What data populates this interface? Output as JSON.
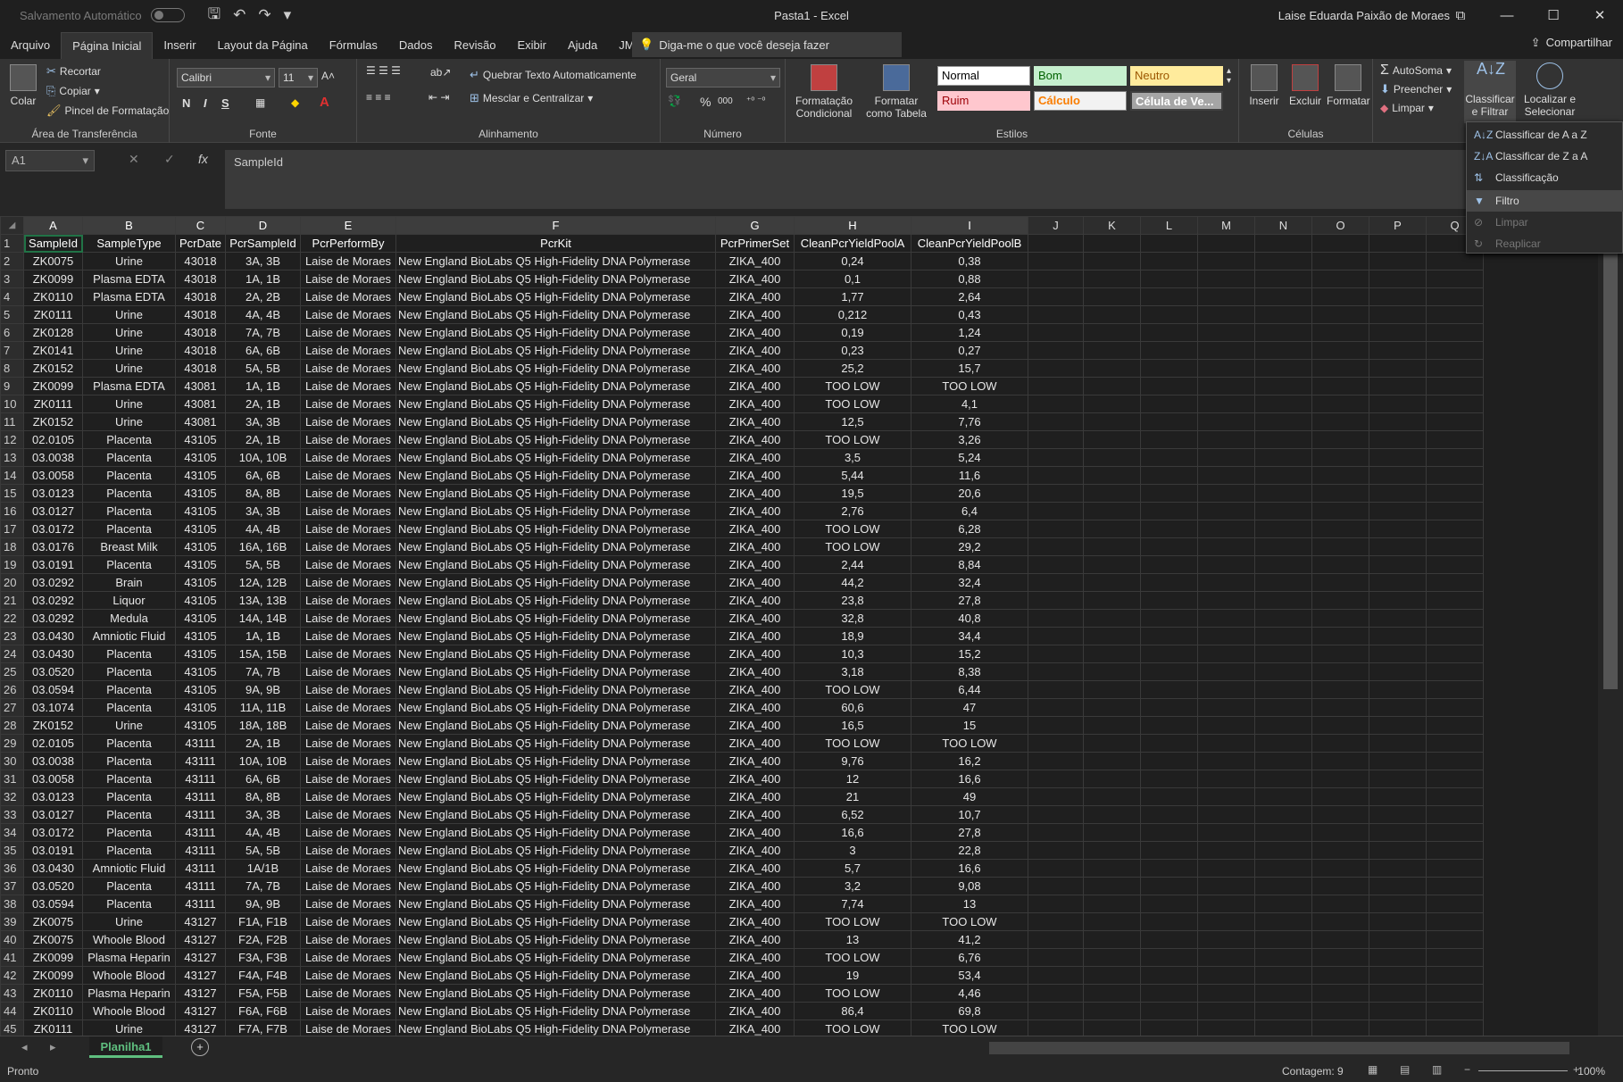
{
  "titlebar": {
    "autosave": "Salvamento Automático",
    "doc_title": "Pasta1  -  Excel",
    "user": "Laise Eduarda Paixão de Moraes",
    "minimize": "—",
    "restore": "☐",
    "close": "✕"
  },
  "tabs": [
    "Arquivo",
    "Página Inicial",
    "Inserir",
    "Layout da Página",
    "Fórmulas",
    "Dados",
    "Revisão",
    "Exibir",
    "Ajuda",
    "JMP"
  ],
  "tellme": "Diga-me o que você deseja fazer",
  "share": "Compartilhar",
  "ribbon": {
    "clipboard": {
      "label": "Área de Transferência",
      "paste": "Colar",
      "cut": "Recortar",
      "copy": "Copiar",
      "painter": "Pincel de Formatação"
    },
    "font": {
      "label": "Fonte",
      "name": "Calibri",
      "size": "11",
      "bold": "N",
      "italic": "I",
      "underline": "S"
    },
    "alignment": {
      "label": "Alinhamento",
      "wrap": "Quebrar Texto Automaticamente",
      "merge": "Mesclar e Centralizar"
    },
    "number": {
      "label": "Número",
      "format": "Geral",
      "percent": "%",
      "thousands": "000"
    },
    "styles": {
      "label": "Estilos",
      "conditional": "Formatação Condicional",
      "as_table": "Formatar como Tabela",
      "normal": "Normal",
      "bom": "Bom",
      "neutro": "Neutro",
      "ruim": "Ruim",
      "calculo": "Cálculo",
      "celula": "Célula de Ve..."
    },
    "cells": {
      "label": "Células",
      "insert": "Inserir",
      "delete": "Excluir",
      "format": "Formatar"
    },
    "editing": {
      "autosum": "AutoSoma",
      "fill": "Preencher",
      "clear": "Limpar",
      "sort": "Classificar e Filtrar",
      "find": "Localizar e Selecionar"
    }
  },
  "formula_bar": {
    "name_box": "A1",
    "cancel": "✕",
    "enter": "✓",
    "fx": "fx",
    "formula": "SampleId"
  },
  "column_headers": [
    "A",
    "B",
    "C",
    "D",
    "E",
    "F",
    "G",
    "H",
    "I",
    "J",
    "K",
    "L",
    "M",
    "N",
    "O",
    "P",
    "Q"
  ],
  "table_header": [
    "SampleId",
    "SampleType",
    "PcrDate",
    "PcrSampleId",
    "PcrPerformBy",
    "PcrKit",
    "PcrPrimerSet",
    "CleanPcrYieldPoolA",
    "CleanPcrYieldPoolB"
  ],
  "rows": [
    [
      "ZK0075",
      "Urine",
      "43018",
      "3A, 3B",
      "Laise de Moraes",
      "New England BioLabs Q5 High-Fidelity DNA Polymerase",
      "ZIKA_400",
      "0,24",
      "0,38"
    ],
    [
      "ZK0099",
      "Plasma EDTA",
      "43018",
      "1A, 1B",
      "Laise de Moraes",
      "New England BioLabs Q5 High-Fidelity DNA Polymerase",
      "ZIKA_400",
      "0,1",
      "0,88"
    ],
    [
      "ZK0110",
      "Plasma EDTA",
      "43018",
      "2A, 2B",
      "Laise de Moraes",
      "New England BioLabs Q5 High-Fidelity DNA Polymerase",
      "ZIKA_400",
      "1,77",
      "2,64"
    ],
    [
      "ZK0111",
      "Urine",
      "43018",
      "4A, 4B",
      "Laise de Moraes",
      "New England BioLabs Q5 High-Fidelity DNA Polymerase",
      "ZIKA_400",
      "0,212",
      "0,43"
    ],
    [
      "ZK0128",
      "Urine",
      "43018",
      "7A, 7B",
      "Laise de Moraes",
      "New England BioLabs Q5 High-Fidelity DNA Polymerase",
      "ZIKA_400",
      "0,19",
      "1,24"
    ],
    [
      "ZK0141",
      "Urine",
      "43018",
      "6A, 6B",
      "Laise de Moraes",
      "New England BioLabs Q5 High-Fidelity DNA Polymerase",
      "ZIKA_400",
      "0,23",
      "0,27"
    ],
    [
      "ZK0152",
      "Urine",
      "43018",
      "5A, 5B",
      "Laise de Moraes",
      "New England BioLabs Q5 High-Fidelity DNA Polymerase",
      "ZIKA_400",
      "25,2",
      "15,7"
    ],
    [
      "ZK0099",
      "Plasma EDTA",
      "43081",
      "1A, 1B",
      "Laise de Moraes",
      "New England BioLabs Q5 High-Fidelity DNA Polymerase",
      "ZIKA_400",
      "TOO LOW",
      "TOO LOW"
    ],
    [
      "ZK0111",
      "Urine",
      "43081",
      "2A, 1B",
      "Laise de Moraes",
      "New England BioLabs Q5 High-Fidelity DNA Polymerase",
      "ZIKA_400",
      "TOO LOW",
      "4,1"
    ],
    [
      "ZK0152",
      "Urine",
      "43081",
      "3A, 3B",
      "Laise de Moraes",
      "New England BioLabs Q5 High-Fidelity DNA Polymerase",
      "ZIKA_400",
      "12,5",
      "7,76"
    ],
    [
      "02.0105",
      "Placenta",
      "43105",
      "2A, 1B",
      "Laise de Moraes",
      "New England BioLabs Q5 High-Fidelity DNA Polymerase",
      "ZIKA_400",
      "TOO LOW",
      "3,26"
    ],
    [
      "03.0038",
      "Placenta",
      "43105",
      "10A, 10B",
      "Laise de Moraes",
      "New England BioLabs Q5 High-Fidelity DNA Polymerase",
      "ZIKA_400",
      "3,5",
      "5,24"
    ],
    [
      "03.0058",
      "Placenta",
      "43105",
      "6A, 6B",
      "Laise de Moraes",
      "New England BioLabs Q5 High-Fidelity DNA Polymerase",
      "ZIKA_400",
      "5,44",
      "11,6"
    ],
    [
      "03.0123",
      "Placenta",
      "43105",
      "8A, 8B",
      "Laise de Moraes",
      "New England BioLabs Q5 High-Fidelity DNA Polymerase",
      "ZIKA_400",
      "19,5",
      "20,6"
    ],
    [
      "03.0127",
      "Placenta",
      "43105",
      "3A, 3B",
      "Laise de Moraes",
      "New England BioLabs Q5 High-Fidelity DNA Polymerase",
      "ZIKA_400",
      "2,76",
      "6,4"
    ],
    [
      "03.0172",
      "Placenta",
      "43105",
      "4A, 4B",
      "Laise de Moraes",
      "New England BioLabs Q5 High-Fidelity DNA Polymerase",
      "ZIKA_400",
      "TOO LOW",
      "6,28"
    ],
    [
      "03.0176",
      "Breast Milk",
      "43105",
      "16A, 16B",
      "Laise de Moraes",
      "New England BioLabs Q5 High-Fidelity DNA Polymerase",
      "ZIKA_400",
      "TOO LOW",
      "29,2"
    ],
    [
      "03.0191",
      "Placenta",
      "43105",
      "5A, 5B",
      "Laise de Moraes",
      "New England BioLabs Q5 High-Fidelity DNA Polymerase",
      "ZIKA_400",
      "2,44",
      "8,84"
    ],
    [
      "03.0292",
      "Brain",
      "43105",
      "12A, 12B",
      "Laise de Moraes",
      "New England BioLabs Q5 High-Fidelity DNA Polymerase",
      "ZIKA_400",
      "44,2",
      "32,4"
    ],
    [
      "03.0292",
      "Liquor",
      "43105",
      "13A, 13B",
      "Laise de Moraes",
      "New England BioLabs Q5 High-Fidelity DNA Polymerase",
      "ZIKA_400",
      "23,8",
      "27,8"
    ],
    [
      "03.0292",
      "Medula",
      "43105",
      "14A, 14B",
      "Laise de Moraes",
      "New England BioLabs Q5 High-Fidelity DNA Polymerase",
      "ZIKA_400",
      "32,8",
      "40,8"
    ],
    [
      "03.0430",
      "Amniotic Fluid",
      "43105",
      "1A, 1B",
      "Laise de Moraes",
      "New England BioLabs Q5 High-Fidelity DNA Polymerase",
      "ZIKA_400",
      "18,9",
      "34,4"
    ],
    [
      "03.0430",
      "Placenta",
      "43105",
      "15A, 15B",
      "Laise de Moraes",
      "New England BioLabs Q5 High-Fidelity DNA Polymerase",
      "ZIKA_400",
      "10,3",
      "15,2"
    ],
    [
      "03.0520",
      "Placenta",
      "43105",
      "7A, 7B",
      "Laise de Moraes",
      "New England BioLabs Q5 High-Fidelity DNA Polymerase",
      "ZIKA_400",
      "3,18",
      "8,38"
    ],
    [
      "03.0594",
      "Placenta",
      "43105",
      "9A, 9B",
      "Laise de Moraes",
      "New England BioLabs Q5 High-Fidelity DNA Polymerase",
      "ZIKA_400",
      "TOO LOW",
      "6,44"
    ],
    [
      "03.1074",
      "Placenta",
      "43105",
      "11A, 11B",
      "Laise de Moraes",
      "New England BioLabs Q5 High-Fidelity DNA Polymerase",
      "ZIKA_400",
      "60,6",
      "47"
    ],
    [
      "ZK0152",
      "Urine",
      "43105",
      "18A, 18B",
      "Laise de Moraes",
      "New England BioLabs Q5 High-Fidelity DNA Polymerase",
      "ZIKA_400",
      "16,5",
      "15"
    ],
    [
      "02.0105",
      "Placenta",
      "43111",
      "2A, 1B",
      "Laise de Moraes",
      "New England BioLabs Q5 High-Fidelity DNA Polymerase",
      "ZIKA_400",
      "TOO LOW",
      "TOO LOW"
    ],
    [
      "03.0038",
      "Placenta",
      "43111",
      "10A, 10B",
      "Laise de Moraes",
      "New England BioLabs Q5 High-Fidelity DNA Polymerase",
      "ZIKA_400",
      "9,76",
      "16,2"
    ],
    [
      "03.0058",
      "Placenta",
      "43111",
      "6A, 6B",
      "Laise de Moraes",
      "New England BioLabs Q5 High-Fidelity DNA Polymerase",
      "ZIKA_400",
      "12",
      "16,6"
    ],
    [
      "03.0123",
      "Placenta",
      "43111",
      "8A, 8B",
      "Laise de Moraes",
      "New England BioLabs Q5 High-Fidelity DNA Polymerase",
      "ZIKA_400",
      "21",
      "49"
    ],
    [
      "03.0127",
      "Placenta",
      "43111",
      "3A, 3B",
      "Laise de Moraes",
      "New England BioLabs Q5 High-Fidelity DNA Polymerase",
      "ZIKA_400",
      "6,52",
      "10,7"
    ],
    [
      "03.0172",
      "Placenta",
      "43111",
      "4A, 4B",
      "Laise de Moraes",
      "New England BioLabs Q5 High-Fidelity DNA Polymerase",
      "ZIKA_400",
      "16,6",
      "27,8"
    ],
    [
      "03.0191",
      "Placenta",
      "43111",
      "5A, 5B",
      "Laise de Moraes",
      "New England BioLabs Q5 High-Fidelity DNA Polymerase",
      "ZIKA_400",
      "3",
      "22,8"
    ],
    [
      "03.0430",
      "Amniotic Fluid",
      "43111",
      "1A/1B",
      "Laise de Moraes",
      "New England BioLabs Q5 High-Fidelity DNA Polymerase",
      "ZIKA_400",
      "5,7",
      "16,6"
    ],
    [
      "03.0520",
      "Placenta",
      "43111",
      "7A, 7B",
      "Laise de Moraes",
      "New England BioLabs Q5 High-Fidelity DNA Polymerase",
      "ZIKA_400",
      "3,2",
      "9,08"
    ],
    [
      "03.0594",
      "Placenta",
      "43111",
      "9A, 9B",
      "Laise de Moraes",
      "New England BioLabs Q5 High-Fidelity DNA Polymerase",
      "ZIKA_400",
      "7,74",
      "13"
    ],
    [
      "ZK0075",
      "Urine",
      "43127",
      "F1A, F1B",
      "Laise de Moraes",
      "New England BioLabs Q5 High-Fidelity DNA Polymerase",
      "ZIKA_400",
      "TOO LOW",
      "TOO LOW"
    ],
    [
      "ZK0075",
      "Whoole Blood",
      "43127",
      "F2A, F2B",
      "Laise de Moraes",
      "New England BioLabs Q5 High-Fidelity DNA Polymerase",
      "ZIKA_400",
      "13",
      "41,2"
    ],
    [
      "ZK0099",
      "Plasma Heparin",
      "43127",
      "F3A, F3B",
      "Laise de Moraes",
      "New England BioLabs Q5 High-Fidelity DNA Polymerase",
      "ZIKA_400",
      "TOO LOW",
      "6,76"
    ],
    [
      "ZK0099",
      "Whoole Blood",
      "43127",
      "F4A, F4B",
      "Laise de Moraes",
      "New England BioLabs Q5 High-Fidelity DNA Polymerase",
      "ZIKA_400",
      "19",
      "53,4"
    ],
    [
      "ZK0110",
      "Plasma Heparin",
      "43127",
      "F5A, F5B",
      "Laise de Moraes",
      "New England BioLabs Q5 High-Fidelity DNA Polymerase",
      "ZIKA_400",
      "TOO LOW",
      "4,46"
    ],
    [
      "ZK0110",
      "Whoole Blood",
      "43127",
      "F6A, F6B",
      "Laise de Moraes",
      "New England BioLabs Q5 High-Fidelity DNA Polymerase",
      "ZIKA_400",
      "86,4",
      "69,8"
    ],
    [
      "ZK0111",
      "Urine",
      "43127",
      "F7A, F7B",
      "Laise de Moraes",
      "New England BioLabs Q5 High-Fidelity DNA Polymerase",
      "ZIKA_400",
      "TOO LOW",
      "TOO LOW"
    ]
  ],
  "sheet": {
    "tab": "Planilha1"
  },
  "status": {
    "ready": "Pronto",
    "count": "Contagem: 9",
    "zoom": "100%"
  },
  "sort_menu": {
    "items": [
      "Classificar de A a Z",
      "Classificar de Z a A",
      "Classificação Personalizada...",
      "Filtro",
      "Limpar",
      "Reaplicar"
    ]
  }
}
